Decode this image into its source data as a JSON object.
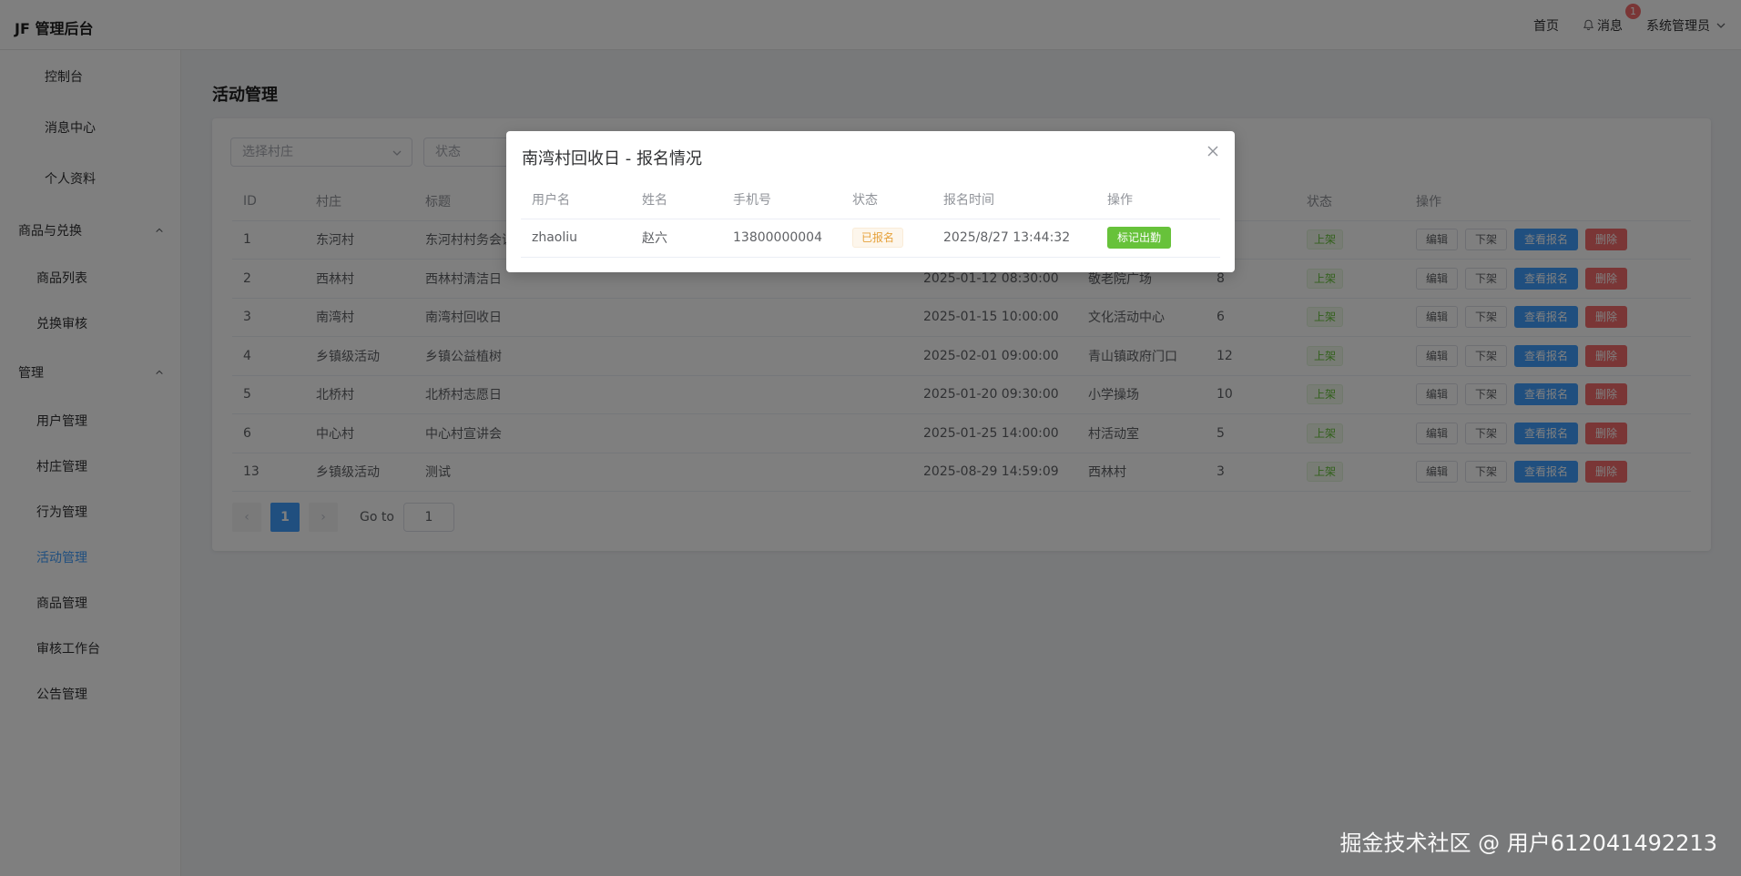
{
  "header": {
    "brand": "JF 管理后台",
    "home": "首页",
    "messages": "消息",
    "message_badge": "1",
    "user": "系统管理员"
  },
  "sidebar": {
    "items": [
      {
        "label": "控制台"
      },
      {
        "label": "消息中心"
      },
      {
        "label": "个人资料"
      }
    ],
    "group1": {
      "label": "商品与兑换",
      "items": [
        "商品列表",
        "兑换审核"
      ]
    },
    "group2": {
      "label": "管理",
      "items": [
        "用户管理",
        "村庄管理",
        "行为管理",
        "活动管理",
        "商品管理",
        "审核工作台",
        "公告管理"
      ]
    },
    "active": "活动管理"
  },
  "page": {
    "title": "活动管理",
    "filters": {
      "village_placeholder": "选择村庄",
      "status_placeholder": "状态"
    },
    "columns": [
      "ID",
      "村庄",
      "标题",
      "",
      "",
      "",
      "状态",
      "操作"
    ],
    "rows": [
      {
        "id": "1",
        "village": "东河村",
        "title": "东河村村务会议",
        "time": "",
        "place": "",
        "count": "",
        "status": "上架"
      },
      {
        "id": "2",
        "village": "西林村",
        "title": "西林村清洁日",
        "time": "2025-01-12 08:30:00",
        "place": "敬老院广场",
        "count": "8",
        "status": "上架"
      },
      {
        "id": "3",
        "village": "南湾村",
        "title": "南湾村回收日",
        "time": "2025-01-15 10:00:00",
        "place": "文化活动中心",
        "count": "6",
        "status": "上架"
      },
      {
        "id": "4",
        "village": "乡镇级活动",
        "title": "乡镇公益植树",
        "time": "2025-02-01 09:00:00",
        "place": "青山镇政府门口",
        "count": "12",
        "status": "上架"
      },
      {
        "id": "5",
        "village": "北桥村",
        "title": "北桥村志愿日",
        "time": "2025-01-20 09:30:00",
        "place": "小学操场",
        "count": "10",
        "status": "上架"
      },
      {
        "id": "6",
        "village": "中心村",
        "title": "中心村宣讲会",
        "time": "2025-01-25 14:00:00",
        "place": "村活动室",
        "count": "5",
        "status": "上架"
      },
      {
        "id": "13",
        "village": "乡镇级活动",
        "title": "测试",
        "time": "2025-08-29 14:59:09",
        "place": "西林村",
        "count": "3",
        "status": "上架"
      }
    ],
    "row_actions": {
      "edit": "编辑",
      "offline": "下架",
      "view": "查看报名",
      "delete": "删除"
    },
    "pagination": {
      "current": "1",
      "goto_label": "Go to",
      "goto_value": "1"
    }
  },
  "dialog": {
    "title": "南湾村回收日 - 报名情况",
    "columns": [
      "用户名",
      "姓名",
      "手机号",
      "状态",
      "报名时间",
      "操作"
    ],
    "rows": [
      {
        "username": "zhaoliu",
        "name": "赵六",
        "phone": "13800000004",
        "status": "已报名",
        "time": "2025/8/27 13:44:32",
        "action": "标记出勤"
      }
    ]
  },
  "watermark": "掘金技术社区 @ 用户612041492213",
  "colors": {
    "primary": "#409eff",
    "danger": "#f56c6c",
    "success": "#67c23a",
    "warning": "#e6a23c"
  }
}
